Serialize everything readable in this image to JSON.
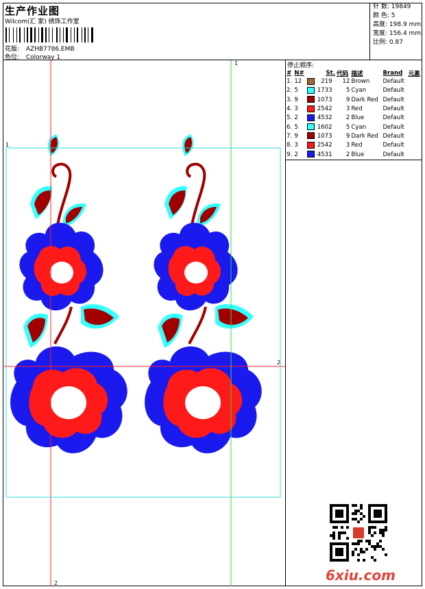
{
  "header": {
    "title": "生产作业图",
    "company": "Wilcom(汇 家) 绣饰工作室",
    "design_file_label": "花版:",
    "design_file": "AZHB7786.EMB",
    "colorway_label": "色位:",
    "colorway": "Colorway 1"
  },
  "stats": {
    "stitches_label": "针 数:",
    "stitches": "19849",
    "colors_label": "颜 色:",
    "colors": "5",
    "height_label": "高度:",
    "height": "198.9 mm",
    "width_label": "宽度:",
    "width": "156.4 mm",
    "scale_label": "比例:",
    "scale": "0.87"
  },
  "markers": {
    "m1": "1",
    "m2": "2"
  },
  "stop_sequence": {
    "title": "停止顺序:",
    "columns": [
      "#",
      "N#",
      "St.",
      "代码",
      "描述",
      "Brand",
      "元素"
    ],
    "rows": [
      {
        "idx": "1.",
        "n": "12",
        "color": "#a0683a",
        "st": "219",
        "code": "12",
        "desc": "Brown",
        "brand": "Default"
      },
      {
        "idx": "2.",
        "n": "5",
        "color": "#33ffff",
        "st": "1733",
        "code": "5",
        "desc": "Cyan",
        "brand": "Default"
      },
      {
        "idx": "3.",
        "n": "9",
        "color": "#a00000",
        "st": "1073",
        "code": "9",
        "desc": "Dark Red",
        "brand": "Default"
      },
      {
        "idx": "4.",
        "n": "3",
        "color": "#ff1a1a",
        "st": "2542",
        "code": "3",
        "desc": "Red",
        "brand": "Default"
      },
      {
        "idx": "5.",
        "n": "2",
        "color": "#1a1aee",
        "st": "4532",
        "code": "2",
        "desc": "Blue",
        "brand": "Default"
      },
      {
        "idx": "6.",
        "n": "5",
        "color": "#33ffff",
        "st": "1602",
        "code": "5",
        "desc": "Cyan",
        "brand": "Default"
      },
      {
        "idx": "7.",
        "n": "9",
        "color": "#a00000",
        "st": "1073",
        "code": "9",
        "desc": "Dark Red",
        "brand": "Default"
      },
      {
        "idx": "8.",
        "n": "3",
        "color": "#ff1a1a",
        "st": "2542",
        "code": "3",
        "desc": "Red",
        "brand": "Default"
      },
      {
        "idx": "9.",
        "n": "2",
        "color": "#1a1aee",
        "st": "4531",
        "code": "2",
        "desc": "Blue",
        "brand": "Default"
      }
    ]
  },
  "watermark": "6xiu.com"
}
